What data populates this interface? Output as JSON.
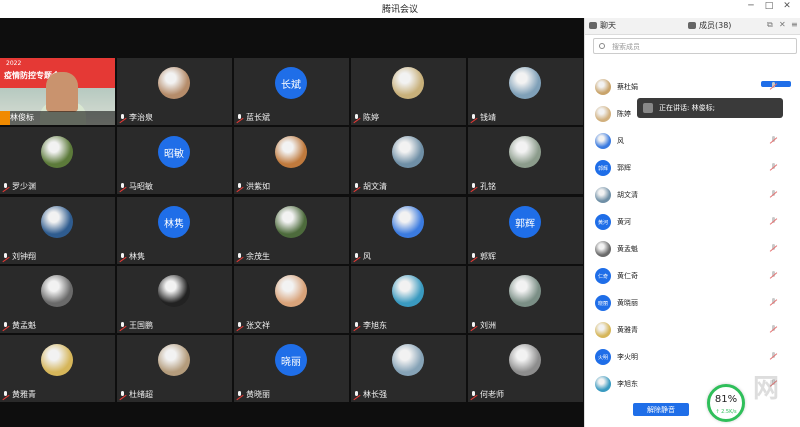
{
  "window": {
    "title": "腾讯会议"
  },
  "live_tile": {
    "banner_year": "2022",
    "banner_text": "疫情防控专题会",
    "name": "林俊标"
  },
  "tiles": [
    {
      "name": "李治泉",
      "avatar": "photo",
      "color": "#b58c6a"
    },
    {
      "name": "蓝长斌",
      "avatar": "长斌"
    },
    {
      "name": "陈婷",
      "avatar": "photo",
      "color": "#c8b07a"
    },
    {
      "name": "钱靖",
      "avatar": "photo",
      "color": "#7fa0b8"
    },
    {
      "name": "罗少渊",
      "avatar": "photo",
      "color": "#5c7a3a"
    },
    {
      "name": "马昭敏",
      "avatar": "昭敏"
    },
    {
      "name": "洪紫如",
      "avatar": "photo",
      "color": "#c07a3d"
    },
    {
      "name": "胡文清",
      "avatar": "photo",
      "color": "#6f8fa6"
    },
    {
      "name": "孔铭",
      "avatar": "photo",
      "color": "#8c9c8c"
    },
    {
      "name": "刘钟翔",
      "avatar": "photo",
      "color": "#2f5c8f"
    },
    {
      "name": "林隽",
      "avatar": "林隽"
    },
    {
      "name": "余茂生",
      "avatar": "photo",
      "color": "#4d6b3c"
    },
    {
      "name": "风",
      "avatar": "photo",
      "color": "#3b7be0"
    },
    {
      "name": "郭辉",
      "avatar": "郭辉"
    },
    {
      "name": "黄孟魁",
      "avatar": "photo",
      "color": "#6a6a6a"
    },
    {
      "name": "王国鹏",
      "avatar": "photo",
      "color": "#222222"
    },
    {
      "name": "张文祥",
      "avatar": "photo",
      "color": "#d9a37a"
    },
    {
      "name": "李旭东",
      "avatar": "photo",
      "color": "#3a9ac0"
    },
    {
      "name": "刘洲",
      "avatar": "photo",
      "color": "#7b8f86"
    },
    {
      "name": "黄雅青",
      "avatar": "photo",
      "color": "#d6b65a"
    },
    {
      "name": "杜绪超",
      "avatar": "photo",
      "color": "#b49c7c"
    },
    {
      "name": "黄晓丽",
      "avatar": "晓丽"
    },
    {
      "name": "林长强",
      "avatar": "photo",
      "color": "#86a3b7"
    },
    {
      "name": "何老师",
      "avatar": "photo",
      "color": "#8d8d8d"
    }
  ],
  "panel": {
    "tab_chat": "聊天",
    "tab_members": "成员(38)",
    "search_placeholder": "搜索成员",
    "speaking": "正在讲话: 林俊标;",
    "mute_all": "解除静音",
    "members": [
      {
        "name": "蔡杜娟",
        "avatar": "photo",
        "color": "#c9a46b"
      },
      {
        "name": "陈婷",
        "avatar": "photo",
        "color": "#d1b07e"
      },
      {
        "name": "风",
        "avatar": "photo",
        "color": "#3b7be0"
      },
      {
        "name": "郭辉",
        "avatar": "郭辉"
      },
      {
        "name": "胡文清",
        "avatar": "photo",
        "color": "#6f8fa6"
      },
      {
        "name": "黄河",
        "avatar": "黄河"
      },
      {
        "name": "黄孟魁",
        "avatar": "photo",
        "color": "#6a6a6a"
      },
      {
        "name": "黄仁奇",
        "avatar": "仁奇"
      },
      {
        "name": "黄晓丽",
        "avatar": "晓丽"
      },
      {
        "name": "黄雅青",
        "avatar": "photo",
        "color": "#d6b65a"
      },
      {
        "name": "李火明",
        "avatar": "火明"
      },
      {
        "name": "李旭东",
        "avatar": "photo",
        "color": "#3a9ac0"
      }
    ]
  },
  "network": {
    "percent": "81%",
    "speed": "↑ 2.5K/s"
  }
}
